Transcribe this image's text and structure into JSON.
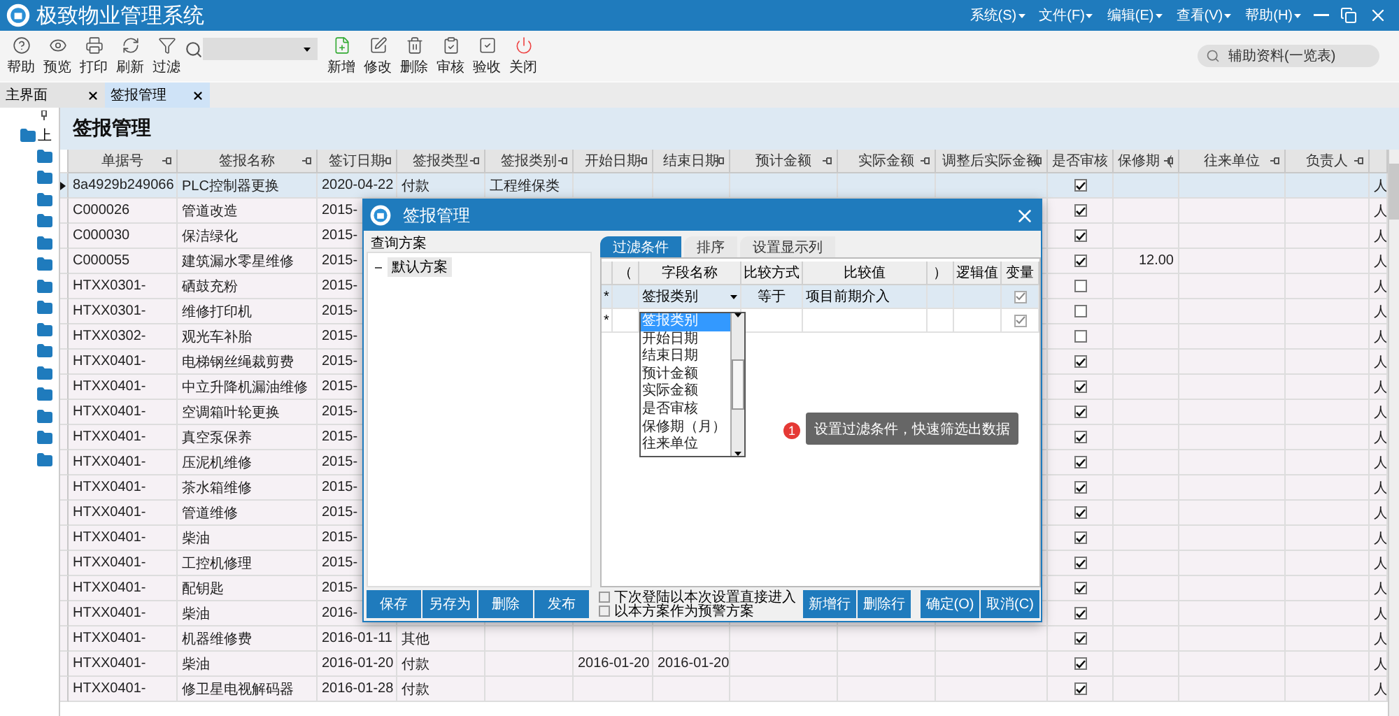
{
  "window": {
    "title": "极致物业管理系统",
    "menus": [
      "系统(S)",
      "文件(F)",
      "编辑(E)",
      "查看(V)",
      "帮助(H)"
    ]
  },
  "toolbar": {
    "left": [
      {
        "label": "帮助"
      },
      {
        "label": "预览"
      },
      {
        "label": "打印"
      },
      {
        "label": "刷新"
      },
      {
        "label": "过滤"
      }
    ],
    "right": [
      {
        "label": "新增"
      },
      {
        "label": "修改"
      },
      {
        "label": "删除"
      },
      {
        "label": "审核"
      },
      {
        "label": "验收"
      },
      {
        "label": "关闭"
      }
    ],
    "aux_search": {
      "placeholder": "辅助资料(一览表)"
    }
  },
  "tabs": [
    {
      "label": "主界面",
      "selected": false
    },
    {
      "label": "签报管理",
      "selected": true
    }
  ],
  "tree": {
    "root": "上"
  },
  "page_title": "签报管理",
  "table": {
    "columns": [
      {
        "label": "单据号",
        "kind": "text",
        "pin": true
      },
      {
        "label": "签报名称",
        "kind": "text",
        "pin": true
      },
      {
        "label": "签订日期",
        "kind": "text",
        "pin": true
      },
      {
        "label": "签报类型",
        "kind": "text",
        "pin": true
      },
      {
        "label": "签报类别",
        "kind": "text",
        "pin": true
      },
      {
        "label": "开始日期",
        "kind": "text",
        "pin": true
      },
      {
        "label": "结束日期",
        "kind": "text",
        "pin": true
      },
      {
        "label": "预计金额",
        "kind": "number",
        "pin": true
      },
      {
        "label": "实际金额",
        "kind": "number",
        "pin": true
      },
      {
        "label": "调整后实际金额",
        "kind": "number",
        "pin": true
      },
      {
        "label": "是否审核",
        "kind": "check",
        "pin": false
      },
      {
        "label": "保修期（",
        "kind": "number",
        "pin": true
      },
      {
        "label": "往来单位",
        "kind": "text",
        "pin": true
      },
      {
        "label": "负责人",
        "kind": "text",
        "pin": true
      },
      {
        "kind": "text",
        "pin": false
      }
    ],
    "rows": [
      {
        "cells": [
          "8a4929b249066",
          "PLC控制器更换",
          "2020-04-22",
          "付款",
          "工程维保类",
          "",
          "",
          "",
          "",
          "",
          "",
          "",
          "",
          "",
          "人"
        ],
        "audited": true,
        "selected": true
      },
      {
        "cells": [
          "C000026",
          "管道改造",
          "2015-",
          "",
          "",
          "",
          "",
          "",
          "",
          "",
          "",
          "",
          "",
          "",
          "人"
        ],
        "audited": true,
        "selected": false
      },
      {
        "cells": [
          "C000030",
          "保洁绿化",
          "2015-",
          "",
          "",
          "",
          "",
          "",
          "",
          "",
          "",
          "",
          "",
          "",
          "人"
        ],
        "audited": true,
        "selected": false
      },
      {
        "cells": [
          "C000055",
          "建筑漏水零星维修",
          "2015-",
          "",
          "",
          "",
          "",
          "",
          "",
          "",
          "",
          "12.00",
          "",
          "",
          "人"
        ],
        "audited": true,
        "selected": false
      },
      {
        "cells": [
          "HTXX0301-",
          "硒鼓充粉",
          "2015-",
          "",
          "",
          "",
          "",
          "",
          "",
          "",
          "",
          "",
          "",
          "",
          "人"
        ],
        "audited": false,
        "selected": false
      },
      {
        "cells": [
          "HTXX0301-",
          "维修打印机",
          "2015-",
          "",
          "",
          "",
          "",
          "",
          "",
          "",
          "",
          "",
          "",
          "",
          "人"
        ],
        "audited": false,
        "selected": false
      },
      {
        "cells": [
          "HTXX0302-",
          "观光车补胎",
          "2015-",
          "",
          "",
          "",
          "",
          "",
          "",
          "",
          "",
          "",
          "",
          "",
          "人"
        ],
        "audited": false,
        "selected": false
      },
      {
        "cells": [
          "HTXX0401-",
          "电梯钢丝绳裁剪费",
          "2015-",
          "",
          "",
          "",
          "",
          "",
          "",
          "",
          "",
          "",
          "",
          "",
          "人"
        ],
        "audited": true,
        "selected": false
      },
      {
        "cells": [
          "HTXX0401-",
          "中立升降机漏油维修",
          "2015-",
          "",
          "",
          "",
          "",
          "",
          "",
          "",
          "",
          "",
          "",
          "",
          "人"
        ],
        "audited": true,
        "selected": false
      },
      {
        "cells": [
          "HTXX0401-",
          "空调箱叶轮更换",
          "2015-",
          "",
          "",
          "",
          "",
          "",
          "",
          "",
          "",
          "",
          "",
          "",
          "人"
        ],
        "audited": true,
        "selected": false
      },
      {
        "cells": [
          "HTXX0401-",
          "真空泵保养",
          "2015-",
          "",
          "",
          "",
          "",
          "",
          "",
          "",
          "",
          "",
          "",
          "",
          "人"
        ],
        "audited": true,
        "selected": false
      },
      {
        "cells": [
          "HTXX0401-",
          "压泥机维修",
          "2015-",
          "",
          "",
          "",
          "",
          "",
          "",
          "",
          "",
          "",
          "",
          "",
          "人"
        ],
        "audited": true,
        "selected": false
      },
      {
        "cells": [
          "HTXX0401-",
          "茶水箱维修",
          "2015-",
          "",
          "",
          "",
          "",
          "",
          "",
          "",
          "",
          "",
          "",
          "",
          "人"
        ],
        "audited": true,
        "selected": false
      },
      {
        "cells": [
          "HTXX0401-",
          "管道维修",
          "2015-",
          "",
          "",
          "",
          "",
          "",
          "",
          "",
          "",
          "",
          "",
          "",
          "人"
        ],
        "audited": true,
        "selected": false
      },
      {
        "cells": [
          "HTXX0401-",
          "柴油",
          "2015-",
          "",
          "",
          "",
          "",
          "",
          "",
          "",
          "",
          "",
          "",
          "",
          "人"
        ],
        "audited": true,
        "selected": false
      },
      {
        "cells": [
          "HTXX0401-",
          "工控机修理",
          "2015-",
          "",
          "",
          "",
          "",
          "",
          "",
          "",
          "",
          "",
          "",
          "",
          "人"
        ],
        "audited": true,
        "selected": false
      },
      {
        "cells": [
          "HTXX0401-",
          "配钥匙",
          "2015-",
          "",
          "",
          "",
          "",
          "",
          "",
          "",
          "",
          "",
          "",
          "",
          "人"
        ],
        "audited": true,
        "selected": false
      },
      {
        "cells": [
          "HTXX0401-",
          "柴油",
          "2016-",
          "",
          "",
          "",
          "",
          "",
          "",
          "",
          "",
          "",
          "",
          "",
          "人"
        ],
        "audited": true,
        "selected": false
      },
      {
        "cells": [
          "HTXX0401-",
          "机器维修费",
          "2016-01-11",
          "其他",
          "",
          "",
          "",
          "",
          "",
          "",
          "",
          "",
          "",
          "",
          "人"
        ],
        "audited": true,
        "selected": false
      },
      {
        "cells": [
          "HTXX0401-",
          "柴油",
          "2016-01-20",
          "付款",
          "",
          "2016-01-20",
          "2016-01-20",
          "",
          "",
          "",
          "",
          "",
          "",
          "",
          "人"
        ],
        "audited": true,
        "selected": false
      },
      {
        "cells": [
          "HTXX0401-",
          "修卫星电视解码器",
          "2016-01-28",
          "付款",
          "",
          "",
          "",
          "",
          "",
          "",
          "",
          "",
          "",
          "",
          "人"
        ],
        "audited": true,
        "selected": false
      }
    ]
  },
  "dialog": {
    "title": "签报管理",
    "schemes_header": "查询方案",
    "schemes": [
      "默认方案"
    ],
    "tabs": [
      {
        "label": "过滤条件",
        "selected": true
      },
      {
        "label": "排序",
        "selected": false
      },
      {
        "label": "设置显示列",
        "selected": false
      }
    ],
    "filter_columns": [
      "（",
      "字段名称",
      "比较方式",
      "比较值",
      "）",
      "逻辑值",
      "变量"
    ],
    "filter_rows": [
      {
        "marker": "*",
        "current": true,
        "field": "签报类别",
        "compare": "等于",
        "value": "项目前期介入",
        "variable": true
      },
      {
        "marker": "*",
        "current": false,
        "variable": true
      }
    ],
    "field_options": [
      {
        "label": "签报类别",
        "selected": true
      },
      {
        "label": "开始日期",
        "selected": false
      },
      {
        "label": "结束日期",
        "selected": false
      },
      {
        "label": "预计金额",
        "selected": false
      },
      {
        "label": "实际金额",
        "selected": false
      },
      {
        "label": "是否审核",
        "selected": false
      },
      {
        "label": "保修期（月）",
        "selected": false
      },
      {
        "label": "往来单位",
        "selected": false
      }
    ],
    "tip": {
      "badge": "1",
      "text": "设置过滤条件，快速筛选出数据"
    },
    "scheme_buttons": [
      "保存",
      "另存为",
      "删除",
      "发布"
    ],
    "options": [
      {
        "label": "下次登陆以本次设置直接进入",
        "checked": false
      },
      {
        "label": "以本方案作为预警方案",
        "checked": false
      }
    ],
    "row_buttons": [
      "新增行",
      "删除行"
    ],
    "confirm_buttons": [
      "确定(O)",
      "取消(C)"
    ]
  }
}
